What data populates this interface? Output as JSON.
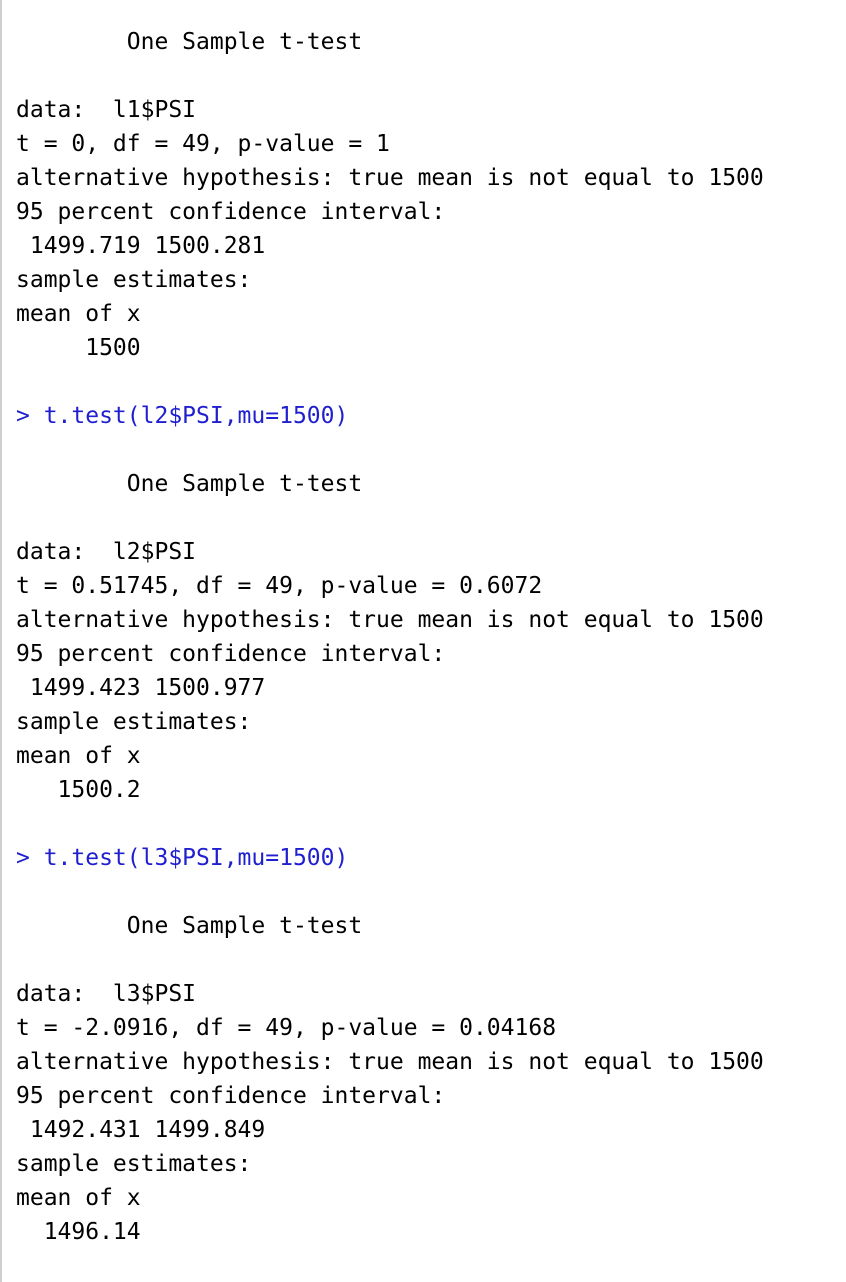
{
  "console": {
    "results": [
      {
        "command": "",
        "title": "One Sample t-test",
        "data_line": "data:  l1$PSI",
        "stats_line": "t = 0, df = 49, p-value = 1",
        "alt_line": "alternative hypothesis: true mean is not equal to 1500",
        "ci_label": "95 percent confidence interval:",
        "ci_values": " 1499.719 1500.281",
        "est_label": "sample estimates:",
        "mean_label": "mean of x",
        "mean_value": "     1500"
      },
      {
        "command": "> t.test(l2$PSI,mu=1500)",
        "title": "One Sample t-test",
        "data_line": "data:  l2$PSI",
        "stats_line": "t = 0.51745, df = 49, p-value = 0.6072",
        "alt_line": "alternative hypothesis: true mean is not equal to 1500",
        "ci_label": "95 percent confidence interval:",
        "ci_values": " 1499.423 1500.977",
        "est_label": "sample estimates:",
        "mean_label": "mean of x",
        "mean_value": "   1500.2"
      },
      {
        "command": "> t.test(l3$PSI,mu=1500)",
        "title": "One Sample t-test",
        "data_line": "data:  l3$PSI",
        "stats_line": "t = -2.0916, df = 49, p-value = 0.04168",
        "alt_line": "alternative hypothesis: true mean is not equal to 1500",
        "ci_label": "95 percent confidence interval:",
        "ci_values": " 1492.431 1499.849",
        "est_label": "sample estimates:",
        "mean_label": "mean of x",
        "mean_value": "  1496.14"
      }
    ]
  }
}
